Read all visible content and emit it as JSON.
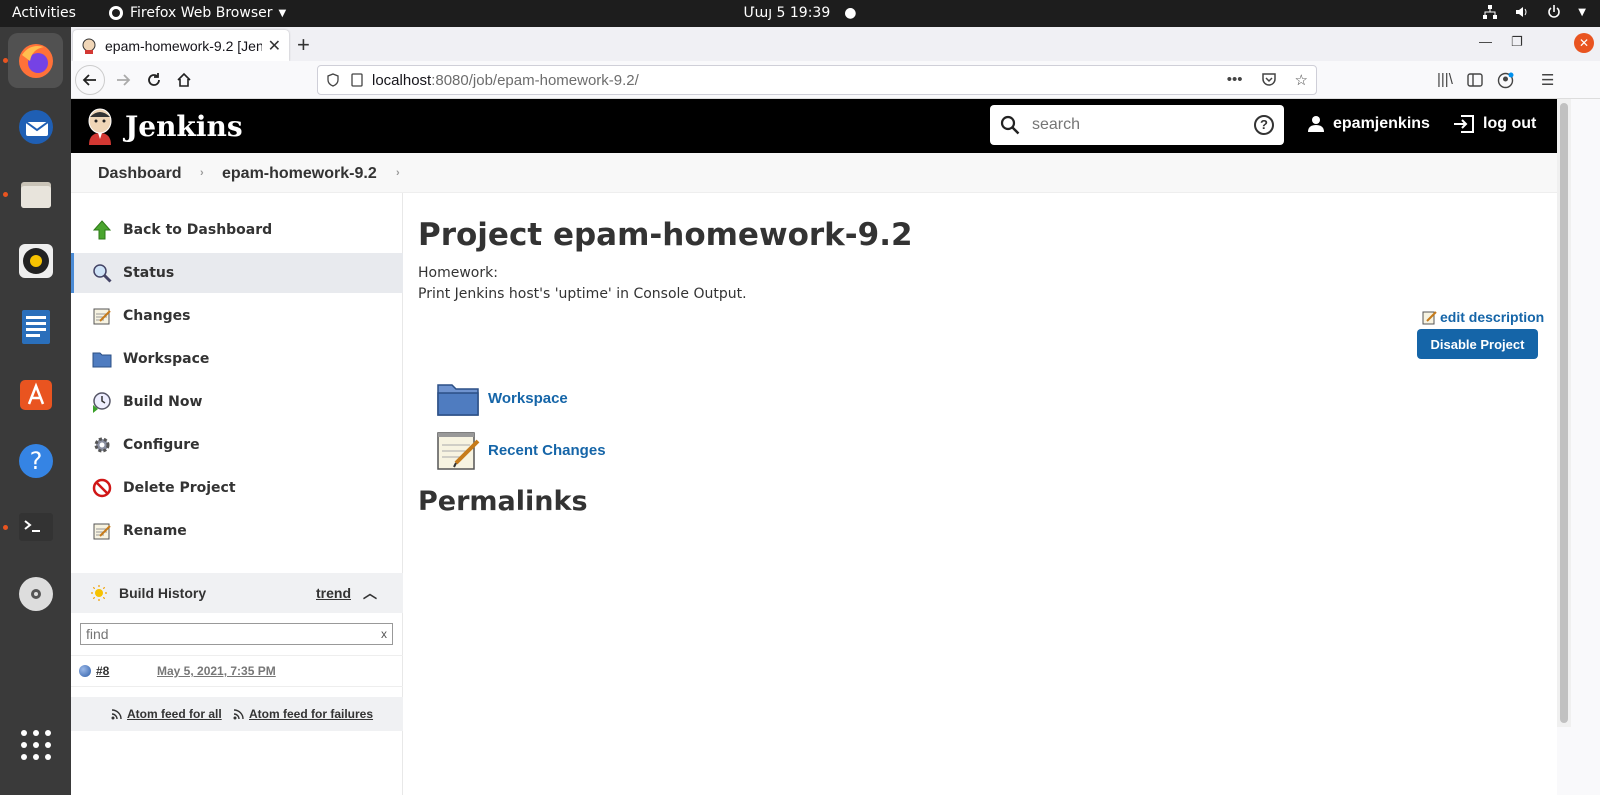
{
  "system": {
    "activities": "Activities",
    "app_menu": "Firefox Web Browser",
    "clock": "Մայ 5  19:39"
  },
  "browser": {
    "tab_title": "epam-homework-9.2 [Jenkins]",
    "url_host": "localhost",
    "url_path": ":8080/job/epam-homework-9.2/"
  },
  "jenkins": {
    "brand": "Jenkins",
    "search_placeholder": "search",
    "username": "epamjenkins",
    "logout": "log out",
    "breadcrumb": [
      "Dashboard",
      "epam-homework-9.2"
    ],
    "tasks": [
      {
        "label": "Back to Dashboard",
        "icon": "up-arrow-icon"
      },
      {
        "label": "Status",
        "icon": "magnifier-icon"
      },
      {
        "label": "Changes",
        "icon": "notepad-icon"
      },
      {
        "label": "Workspace",
        "icon": "folder-icon"
      },
      {
        "label": "Build Now",
        "icon": "clock-icon"
      },
      {
        "label": "Configure",
        "icon": "gear-icon"
      },
      {
        "label": "Delete Project",
        "icon": "no-entry-icon"
      },
      {
        "label": "Rename",
        "icon": "notepad-icon"
      }
    ],
    "build_history": {
      "title": "Build History",
      "trend": "trend",
      "find_placeholder": "find",
      "find_clear": "x",
      "builds": [
        {
          "number": "#8",
          "date": "May 5, 2021, 7:35 PM",
          "status_color": "#2d5ea8"
        }
      ],
      "feed_all": "Atom feed for all",
      "feed_failures": "Atom feed for failures"
    },
    "project": {
      "title": "Project epam-homework-9.2",
      "description_line1": "Homework:",
      "description_line2": "Print Jenkins host's 'uptime' in Console Output.",
      "edit_description": "edit description",
      "disable_button": "Disable Project",
      "links": [
        "Workspace",
        "Recent Changes"
      ],
      "permalinks_heading": "Permalinks"
    }
  },
  "colors": {
    "link": "#1565a8",
    "header": "#000000",
    "ubuntu_accent": "#e95420"
  }
}
